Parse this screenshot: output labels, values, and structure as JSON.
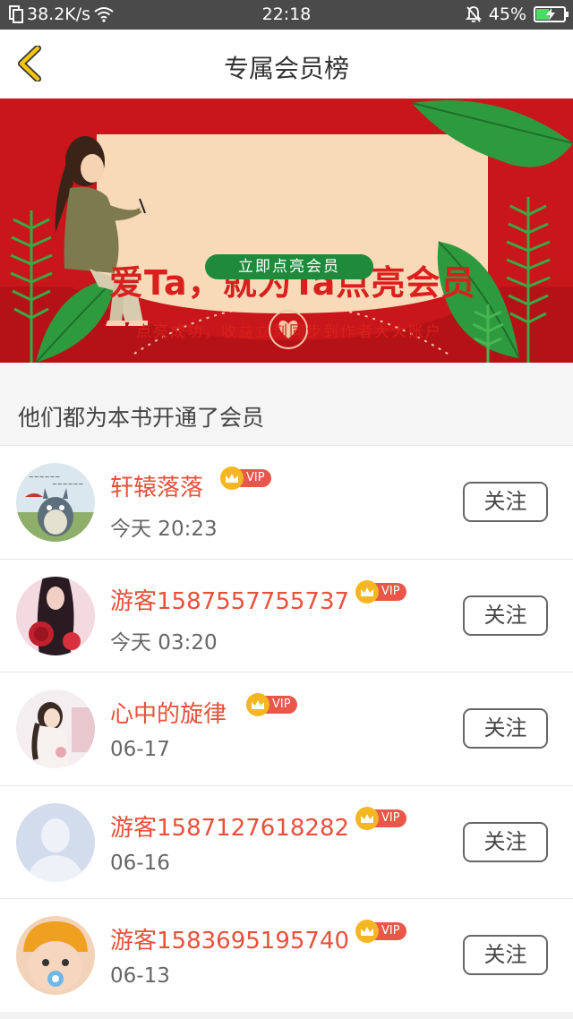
{
  "status_bar": {
    "speed": "38.2K/s",
    "time": "22:18",
    "battery": "45%",
    "battery_level": 0.45
  },
  "header": {
    "title": "专属会员榜",
    "back_icon": "chevron-left-icon"
  },
  "banner": {
    "title": "爱Ta，就为Ta点亮会员",
    "subtitle": "点亮成功，收益立刻同步到作者大大账户",
    "cta": "立即点亮会员"
  },
  "section": {
    "title": "他们都为本书开通了会员"
  },
  "members": [
    {
      "name": "轩辕落落",
      "badge": "VIP",
      "time": "今天 20:23",
      "follow": "关注",
      "avatar": "totoro"
    },
    {
      "name": "游客1587557755737",
      "badge": "VIP",
      "time": "今天 03:20",
      "follow": "关注",
      "avatar": "rose"
    },
    {
      "name": "心中的旋律",
      "badge": "VIP",
      "time": "06-17",
      "follow": "关注",
      "avatar": "girl"
    },
    {
      "name": "游客1587127618282",
      "badge": "VIP",
      "time": "06-16",
      "follow": "关注",
      "avatar": "default"
    },
    {
      "name": "游客1583695195740",
      "badge": "VIP",
      "time": "06-13",
      "follow": "关注",
      "avatar": "baby"
    }
  ],
  "colors": {
    "accent_name": "#e8503a",
    "banner_red": "#c8161b",
    "cta_green": "#1e8a3c",
    "back_yellow": "#f2c511"
  }
}
